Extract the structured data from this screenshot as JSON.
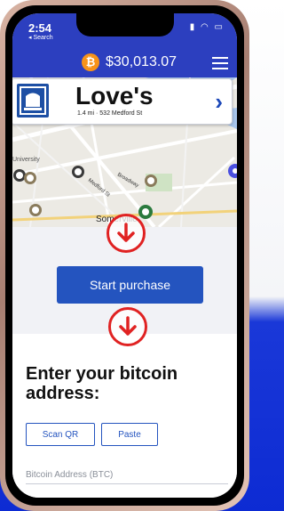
{
  "status": {
    "time": "2:54",
    "back_label": "◂ Search"
  },
  "appbar": {
    "price": "$30,013.07",
    "bitcoin_symbol": "₿",
    "menu_icon": "hamburger-icon"
  },
  "map": {
    "labels": [
      "University",
      "Somerville",
      "Medford St",
      "Broadway"
    ],
    "pins": [
      "bank-pin-icon",
      "bank-pin-icon",
      "bank-pin-icon",
      "bank-pin-icon",
      "bank-pin-icon",
      "bank-pin-icon",
      "location-pin-icon"
    ]
  },
  "store": {
    "name": "Love's",
    "info": "1.4 mi · 532 Medford St",
    "chevron_icon": "chevron-right-icon"
  },
  "purchase": {
    "start_label": "Start purchase"
  },
  "address": {
    "title": "Enter your bitcoin address:",
    "scan_label": "Scan QR",
    "paste_label": "Paste",
    "input_label": "Bitcoin Address (BTC)"
  },
  "colors": {
    "brand_blue": "#2c3fbf",
    "button_blue": "#2454bf",
    "bitcoin_orange": "#f7931a",
    "arrow_red": "#e02222"
  }
}
